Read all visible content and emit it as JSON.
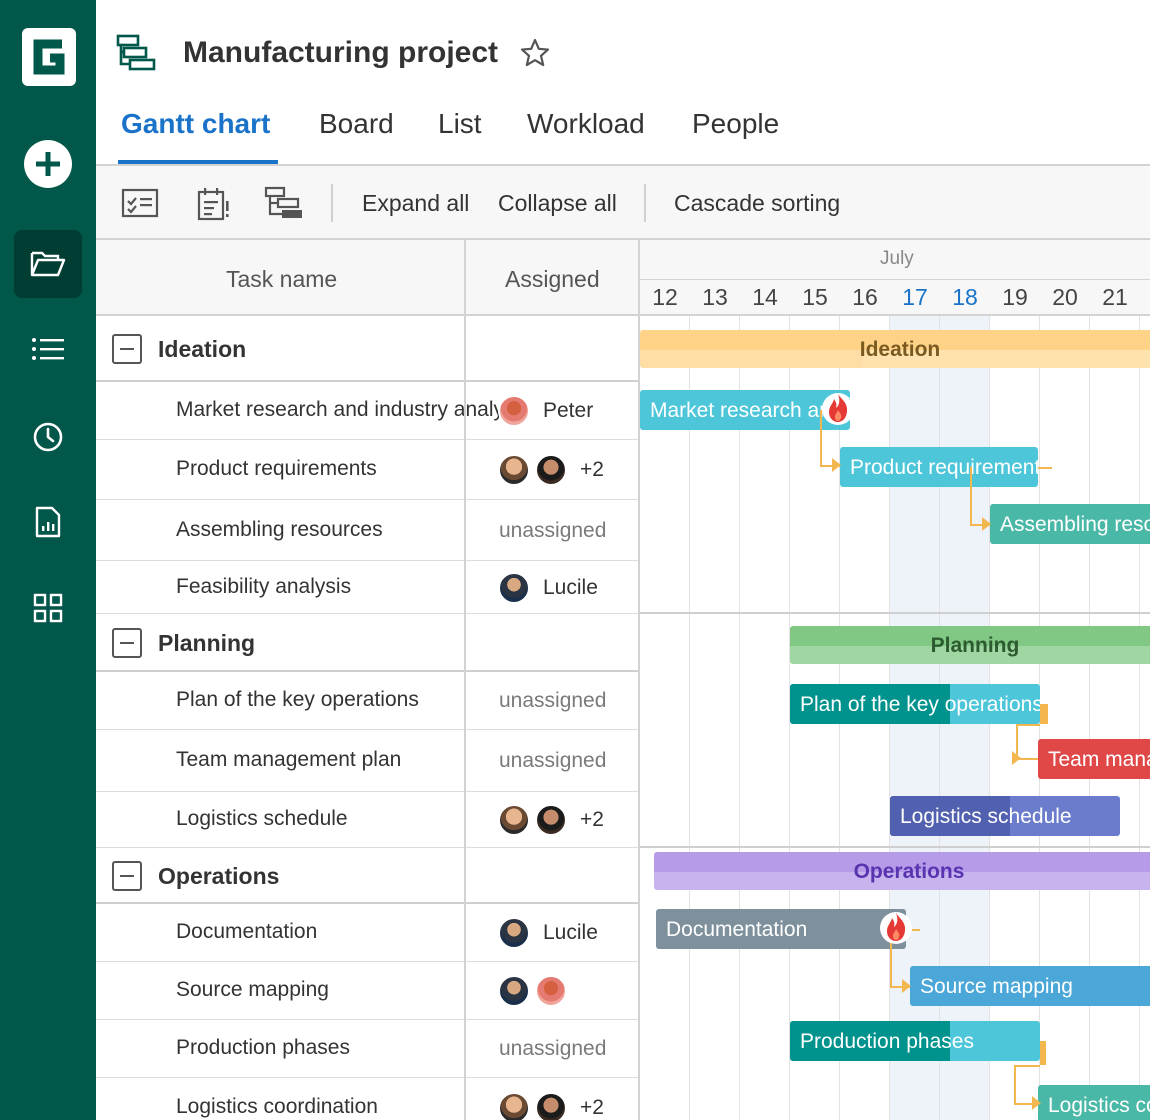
{
  "app": {
    "logo_letter": "G"
  },
  "project": {
    "title": "Manufacturing project"
  },
  "tabs": [
    {
      "label": "Gantt chart",
      "active": true
    },
    {
      "label": "Board"
    },
    {
      "label": "List"
    },
    {
      "label": "Workload"
    },
    {
      "label": "People"
    }
  ],
  "toolbar": {
    "expand_all": "Expand all",
    "collapse_all": "Collapse all",
    "cascade_sorting": "Cascade sorting"
  },
  "grid": {
    "col_task": "Task name",
    "col_assigned": "Assigned"
  },
  "timeline": {
    "month": "July",
    "days": [
      "12",
      "13",
      "14",
      "15",
      "16",
      "17",
      "18",
      "19",
      "20",
      "21"
    ],
    "highlight_days": [
      "17",
      "18"
    ]
  },
  "groups": [
    {
      "name": "Ideation",
      "tasks": [
        {
          "name": "Market research and industry analysis",
          "assigned": "Peter",
          "avatars": [
            "p"
          ]
        },
        {
          "name": "Product requirements",
          "assigned": "+2",
          "avatars": [
            "a",
            "b"
          ]
        },
        {
          "name": "Assembling resources",
          "assigned": "unassigned",
          "avatars": []
        },
        {
          "name": "Feasibility analysis",
          "assigned": "Lucile",
          "avatars": [
            "l"
          ]
        }
      ]
    },
    {
      "name": "Planning",
      "tasks": [
        {
          "name": "Plan of the key operations",
          "assigned": "unassigned",
          "avatars": []
        },
        {
          "name": "Team management plan",
          "assigned": "unassigned",
          "avatars": []
        },
        {
          "name": "Logistics schedule",
          "assigned": "+2",
          "avatars": [
            "a",
            "b"
          ]
        }
      ]
    },
    {
      "name": "Operations",
      "tasks": [
        {
          "name": "Documentation",
          "assigned": "Lucile",
          "avatars": [
            "l"
          ]
        },
        {
          "name": "Source mapping",
          "assigned": "",
          "avatars": [
            "l",
            "p"
          ]
        },
        {
          "name": "Production phases",
          "assigned": "unassigned",
          "avatars": []
        },
        {
          "name": "Logistics coordination",
          "assigned": "+2",
          "avatars": [
            "a",
            "b"
          ]
        }
      ]
    }
  ],
  "bars": {
    "ideation": "Ideation",
    "market_research": "Market research and industry analysis",
    "product_requirements": "Product requirements",
    "assembling_resources": "Assembling resources",
    "planning": "Planning",
    "plan_key_operations": "Plan of the key operations",
    "team_management": "Team management plan",
    "logistics_schedule": "Logistics schedule",
    "operations": "Operations",
    "documentation": "Documentation",
    "source_mapping": "Source mapping",
    "production_phases": "Production phases",
    "logistics_coordination": "Logistics coordination"
  },
  "colors": {
    "sidebar": "#00574a",
    "accent": "#1a73c9",
    "ideation": "#ffd387",
    "planning": "#80c883",
    "operations": "#b59be8",
    "task_teal": "#4ec6da",
    "task_green": "#4ab8a6",
    "task_red": "#e04848",
    "task_indigo": "#6b7ccc",
    "task_grey": "#7d909b",
    "task_blue": "#4aa7d8"
  }
}
